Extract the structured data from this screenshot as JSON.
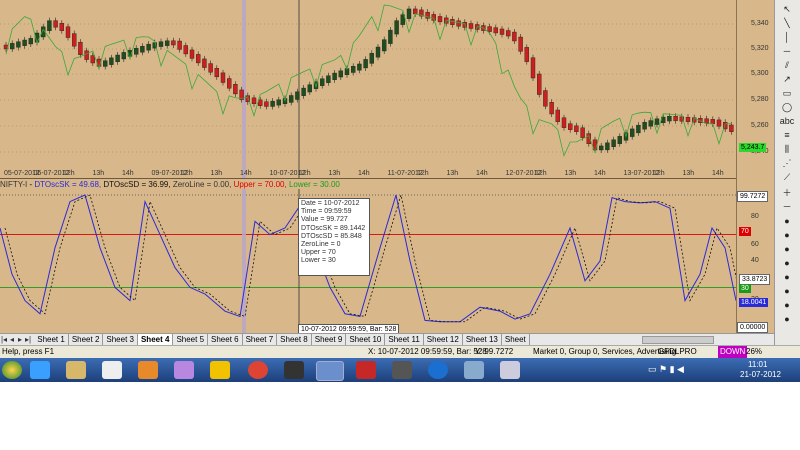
{
  "price_chart": {
    "y_ticks": [
      "5,340",
      "5,320",
      "5,300",
      "5,280",
      "5,260",
      "5,240"
    ],
    "x_ticks": [
      "05-07-2012",
      "06-07-2012",
      "12h",
      "13h",
      "14h",
      "09-07-2012",
      "12h",
      "13h",
      "14h",
      "10-07-2012",
      "12h",
      "13h",
      "14h",
      "11-07-2012",
      "12h",
      "13h",
      "14h",
      "12-07-2012",
      "12h",
      "13h",
      "14h",
      "13-07-2012",
      "12h",
      "13h",
      "14h"
    ],
    "last_price": "5,243.7"
  },
  "indicator": {
    "symbol": "NIFTY-I",
    "sk_label": "DTOscSK = 49.68,",
    "sd_label": "DTOscSD = 36.99,",
    "zero_label": "ZeroLine = 0.00,",
    "upper_label": "Upper = 70.00,",
    "lower_label": "Lower = 30.00",
    "axis_top": "99.7272",
    "axis_80": "80",
    "axis_70": "70",
    "axis_60": "60",
    "axis_40": "40",
    "axis_cursor": "33.8723",
    "axis_30": "30",
    "axis_20": "20",
    "axis_sk": "18.0041",
    "axis_zero": "0.00000"
  },
  "tooltip": {
    "lines": [
      "Date = 10-07-2012",
      "Time = 09:59:59",
      "Value = 99.727",
      "DTOscSK = 89.1442",
      "DTOscSD = 85.848",
      "ZeroLine = 0",
      "Upper = 70",
      "Lower = 30"
    ],
    "cursor_label": "10-07-2012 09:59:59, Bar: 528"
  },
  "sheets": [
    "Sheet 1",
    "Sheet 2",
    "Sheet 3",
    "Sheet 4",
    "Sheet 5",
    "Sheet 6",
    "Sheet 7",
    "Sheet 8",
    "Sheet 9",
    "Sheet 10",
    "Sheet 11",
    "Sheet 12",
    "Sheet 13",
    "Sheet"
  ],
  "active_sheet": "Sheet 4",
  "status": {
    "help": "Help, press F1",
    "x": "X: 10-07-2012 09:59:59, Bar: 528",
    "y": "Y: 99.7272",
    "market": "Market 0, Group 0, Services, Advertising",
    "symbol": "GFDLPRO",
    "trend": "DOWN",
    "pct": "26%"
  },
  "taskbar": {
    "time": "11:01",
    "date": "21-07-2012"
  },
  "colors": {
    "chart_bg": "#D8B88A",
    "bull": "#1f4d1f",
    "bear": "#cc1f1f",
    "sk_line": "#2a2ad8",
    "sd_line": "#111111",
    "upper": "#dd0000",
    "lower": "#1a9a1a"
  }
}
